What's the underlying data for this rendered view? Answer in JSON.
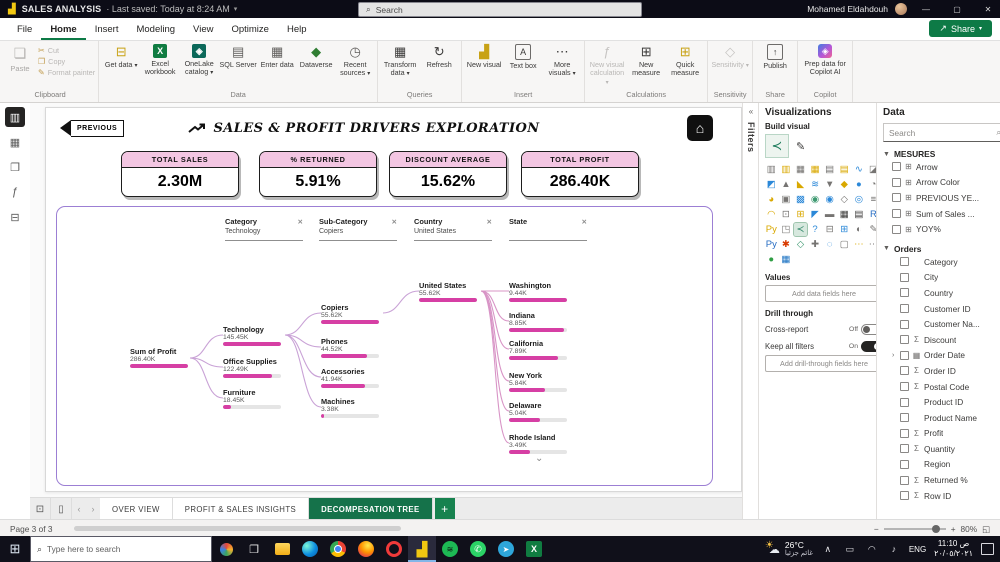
{
  "titlebar": {
    "app_title": "SALES ANALYSIS",
    "saved_status": "Last saved: Today at 8:24 AM",
    "search_placeholder": "Search",
    "user_name": "Mohamed Eldahdouh"
  },
  "menubar": {
    "tabs": [
      {
        "label": "File",
        "name": "menu-tab-file"
      },
      {
        "label": "Home",
        "cls": "active",
        "name": "menu-tab-home"
      },
      {
        "label": "Insert",
        "name": "menu-tab-insert"
      },
      {
        "label": "Modeling",
        "name": "menu-tab-modeling"
      },
      {
        "label": "View",
        "name": "menu-tab-view"
      },
      {
        "label": "Optimize",
        "name": "menu-tab-optimize"
      },
      {
        "label": "Help",
        "name": "menu-tab-help"
      }
    ],
    "share_label": "Share"
  },
  "ribbon": {
    "clipboard": {
      "label": "Clipboard",
      "paste_label": "Paste",
      "items": [
        {
          "g": "✂",
          "label": "Cut",
          "name": "cut-button"
        },
        {
          "g": "❐",
          "label": "Copy",
          "name": "copy-button"
        },
        {
          "g": "✎",
          "label": "Format painter",
          "name": "format-painter-button"
        }
      ]
    },
    "groups": [
      {
        "label": "Data",
        "items": [
          {
            "label": "Get data",
            "g": "⊟",
            "c": "#c8a215",
            "caret": "▾",
            "name": "get-data-button"
          },
          {
            "label": "Excel workbook",
            "g": "X",
            "bg": "#107c41",
            "c": "#ffffff",
            "name": "excel-workbook-button"
          },
          {
            "label": "OneLake catalog",
            "g": "◈",
            "bg": "#0c695a",
            "c": "#ffffff",
            "caret": "▾",
            "name": "onelake-catalog-button"
          },
          {
            "label": "SQL Server",
            "g": "▤",
            "c": "#5f5d5b",
            "name": "sql-server-button"
          },
          {
            "label": "Enter data",
            "g": "▦",
            "c": "#5f5d5b",
            "name": "enter-data-button"
          },
          {
            "label": "Dataverse",
            "g": "◆",
            "c": "#2f7d32",
            "name": "dataverse-button"
          },
          {
            "label": "Recent sources",
            "g": "◷",
            "c": "#5f5d5b",
            "caret": "▾",
            "name": "recent-sources-button"
          }
        ]
      },
      {
        "label": "Queries",
        "items": [
          {
            "label": "Transform data",
            "g": "▦",
            "c": "#3b3a39",
            "caret": "▾",
            "name": "transform-data-button"
          },
          {
            "label": "Refresh",
            "g": "↻",
            "c": "#3b3a39",
            "name": "refresh-button"
          }
        ]
      },
      {
        "label": "Insert",
        "items": [
          {
            "label": "New visual",
            "g": "▟",
            "c": "#c8a215",
            "name": "new-visual-button"
          },
          {
            "label": "Text box",
            "g": "A",
            "outline": true,
            "c": "#3b3a39",
            "name": "text-box-button"
          },
          {
            "label": "More visuals",
            "g": "⋯",
            "c": "#3b3a39",
            "caret": "▾",
            "name": "more-visuals-button"
          }
        ]
      },
      {
        "label": "Calculations",
        "items": [
          {
            "label": "New visual calculation",
            "g": "ƒ",
            "cls": "disabled",
            "caret": "▾",
            "name": "new-visual-calculation-button"
          },
          {
            "label": "New measure",
            "g": "⊞",
            "c": "#3b3a39",
            "name": "new-measure-button"
          },
          {
            "label": "Quick measure",
            "g": "⊞",
            "c": "#c8a215",
            "name": "quick-measure-button"
          }
        ]
      },
      {
        "label": "Sensitivity",
        "items": [
          {
            "label": "Sensitivity",
            "g": "◇",
            "cls": "disabled",
            "caret": "▾",
            "name": "sensitivity-button"
          }
        ]
      },
      {
        "label": "Share",
        "items": [
          {
            "label": "Publish",
            "g": "↑",
            "outline": true,
            "c": "#3b3a39",
            "name": "publish-button"
          }
        ]
      },
      {
        "label": "Copilot",
        "items": [
          {
            "label": "Prep data for Copilot AI",
            "g": "◈",
            "grad": true,
            "name": "prep-data-for-copilot-button"
          }
        ]
      }
    ]
  },
  "leftnav": {
    "items": [
      {
        "g": "▥",
        "cls": "active",
        "name": "report-view-icon"
      },
      {
        "g": "▦",
        "name": "table-view-icon"
      },
      {
        "g": "❐",
        "name": "model-view-icon"
      },
      {
        "g": "ƒ",
        "name": "dax-query-view-icon"
      },
      {
        "g": "⊟",
        "name": "tmdl-view-icon"
      }
    ]
  },
  "report": {
    "prev_label": "PREVIOUS",
    "title": "SALES & PROFIT DRIVERS EXPLORATION",
    "home_glyph": "⌂",
    "cards": [
      {
        "title": "TOTAL SALES",
        "value": "2.30M"
      },
      {
        "title": "% RETURNED",
        "value": "5.91%"
      },
      {
        "title": "DISCOUNT AVERAGE",
        "value": "15.62%"
      },
      {
        "title": "TOTAL PROFIT",
        "value": "286.40K"
      }
    ],
    "slicers": [
      {
        "label": "Category",
        "value": "Technology"
      },
      {
        "label": "Sub-Category",
        "value": "Copiers"
      },
      {
        "label": "Country",
        "value": "United States"
      },
      {
        "label": "State",
        "value": ""
      }
    ],
    "tree": {
      "nodes": [
        {
          "label": "Sum of Profit",
          "value": "286.40K",
          "num": 286.4,
          "col": 0
        },
        {
          "label": "Technology",
          "value": "145.45K",
          "num": 145.45,
          "col": 1
        },
        {
          "label": "Office Supplies",
          "value": "122.49K",
          "num": 122.49,
          "col": 1
        },
        {
          "label": "Furniture",
          "value": "18.45K",
          "num": 18.45,
          "col": 1
        },
        {
          "label": "Copiers",
          "value": "55.62K",
          "num": 55.62,
          "col": 2
        },
        {
          "label": "Phones",
          "value": "44.52K",
          "num": 44.52,
          "col": 2
        },
        {
          "label": "Accessories",
          "value": "41.94K",
          "num": 41.94,
          "col": 2
        },
        {
          "label": "Machines",
          "value": "3.38K",
          "num": 3.38,
          "col": 2
        },
        {
          "label": "United States",
          "value": "55.62K",
          "num": 55.62,
          "col": 3
        },
        {
          "label": "Washington",
          "value": "9.44K",
          "num": 9.44,
          "col": 4
        },
        {
          "label": "Indiana",
          "value": "8.85K",
          "num": 8.85,
          "col": 4
        },
        {
          "label": "California",
          "value": "7.89K",
          "num": 7.89,
          "col": 4
        },
        {
          "label": "New York",
          "value": "5.84K",
          "num": 5.84,
          "col": 4
        },
        {
          "label": "Delaware",
          "value": "5.04K",
          "num": 5.04,
          "col": 4
        },
        {
          "label": "Rhode Island",
          "value": "3.49K",
          "num": 3.49,
          "col": 4
        }
      ]
    }
  },
  "pages": {
    "tabs": [
      {
        "label": "OVER VIEW",
        "name": "page-tab-overview"
      },
      {
        "label": "PROFIT & SALES INSIGHTS",
        "name": "page-tab-profit-sales-insights"
      },
      {
        "label": "DECOMPESATION TREE",
        "cls": "active",
        "name": "page-tab-decomposition-tree"
      }
    ],
    "add_label": "+"
  },
  "statusbar": {
    "page_indicator": "Page 3 of 3",
    "zoom": "80%"
  },
  "filters_panel": {
    "title": "Filters"
  },
  "viz_panel": {
    "title": "Visualizations",
    "build_visual": "Build visual",
    "values_label": "Values",
    "values_placeholder": "Add data fields here",
    "drill_label": "Drill through",
    "cross_report_label": "Cross-report",
    "cross_report_state": "Off",
    "keep_filters_label": "Keep all filters",
    "keep_filters_state": "On",
    "drill_placeholder": "Add drill-through fields here",
    "icons": [
      {
        "g": "▥",
        "c": "#767472"
      },
      {
        "g": "▥",
        "c": "#d9a800"
      },
      {
        "g": "▦",
        "c": "#767472"
      },
      {
        "g": "▦",
        "c": "#d9a800"
      },
      {
        "g": "▤",
        "c": "#767472"
      },
      {
        "g": "▤",
        "c": "#d9a800"
      },
      {
        "g": "∿",
        "c": "#2b88d8"
      },
      {
        "g": "◪",
        "c": "#767472"
      },
      {
        "g": "◩",
        "c": "#2b88d8"
      },
      {
        "g": "▲",
        "c": "#767472"
      },
      {
        "g": "◣",
        "c": "#d9a800"
      },
      {
        "g": "≋",
        "c": "#2b88d8"
      },
      {
        "g": "▼",
        "c": "#767472"
      },
      {
        "g": "◆",
        "c": "#d9a800"
      },
      {
        "g": "●",
        "c": "#2b88d8"
      },
      {
        "g": "◔",
        "c": "#767472"
      },
      {
        "g": "◕",
        "c": "#d9a800"
      },
      {
        "g": "▣",
        "c": "#767472"
      },
      {
        "g": "▩",
        "c": "#2b88d8"
      },
      {
        "g": "◉",
        "c": "#3d9970"
      },
      {
        "g": "◉",
        "c": "#2b88d8"
      },
      {
        "g": "◇",
        "c": "#767472"
      },
      {
        "g": "◎",
        "c": "#2b88d8"
      },
      {
        "g": "≡",
        "c": "#767472"
      },
      {
        "g": "◠",
        "c": "#d9a800"
      },
      {
        "g": "⊡",
        "c": "#767472"
      },
      {
        "g": "⊞",
        "c": "#d9a800"
      },
      {
        "g": "◤",
        "c": "#2b88d8"
      },
      {
        "g": "▬",
        "c": "#767472"
      },
      {
        "g": "▦",
        "c": "#3b3a39"
      },
      {
        "g": "▤",
        "c": "#3b3a39"
      },
      {
        "g": "R",
        "c": "#276dc3"
      },
      {
        "g": "Py",
        "c": "#d9a800"
      },
      {
        "g": "◳",
        "c": "#767472"
      },
      {
        "g": "≺",
        "c": "#1b7a5a",
        "cls": "sel",
        "name": "decomposition-tree-icon"
      },
      {
        "g": "?",
        "c": "#2b88d8"
      },
      {
        "g": "⊟",
        "c": "#767472"
      },
      {
        "g": "⊞",
        "c": "#2b88d8"
      },
      {
        "g": "◐",
        "c": "#767472"
      },
      {
        "g": "✎",
        "c": "#767472"
      },
      {
        "g": "Py",
        "c": "#276dc3"
      },
      {
        "g": "✱",
        "c": "#d83b01"
      },
      {
        "g": "◇",
        "c": "#3d9970"
      },
      {
        "g": "✚",
        "c": "#767472"
      },
      {
        "g": "◌",
        "c": "#2b88d8"
      },
      {
        "g": "▢",
        "c": "#767472"
      },
      {
        "g": "⋯",
        "c": "#d9a800"
      },
      {
        "g": "⋯",
        "c": "#767472"
      },
      {
        "g": "●",
        "c": "#2f9e44",
        "name": "power-automate-icon"
      },
      {
        "g": "▦",
        "c": "#1971c2",
        "name": "arcgis-icon"
      }
    ]
  },
  "data_panel": {
    "title": "Data",
    "search_placeholder": "Search",
    "measures_group": "MESURES",
    "orders_group": "Orders",
    "measures": [
      {
        "icon": "⊞",
        "label": "Arrow"
      },
      {
        "icon": "⊞",
        "label": "Arrow Color"
      },
      {
        "icon": "⊞",
        "label": "PREVIOUS YE..."
      },
      {
        "icon": "⊞",
        "label": "Sum of Sales ..."
      },
      {
        "icon": "⊞",
        "label": "YOY%"
      }
    ],
    "orders": [
      {
        "label": "Category"
      },
      {
        "label": "City"
      },
      {
        "label": "Country"
      },
      {
        "label": "Customer ID"
      },
      {
        "label": "Customer Na..."
      },
      {
        "icon": "Σ",
        "label": "Discount"
      },
      {
        "exp": "›",
        "icon": "▦",
        "label": "Order Date"
      },
      {
        "icon": "Σ",
        "label": "Order ID"
      },
      {
        "icon": "Σ",
        "label": "Postal Code"
      },
      {
        "label": "Product ID"
      },
      {
        "label": "Product Name"
      },
      {
        "icon": "Σ",
        "label": "Profit"
      },
      {
        "icon": "Σ",
        "label": "Quantity"
      },
      {
        "label": "Region"
      },
      {
        "icon": "Σ",
        "label": "Returned %"
      },
      {
        "icon": "Σ",
        "label": "Row ID"
      }
    ]
  },
  "taskbar": {
    "search_placeholder": "Type here to search",
    "apps": [
      {
        "name": "task-view-icon",
        "ic": "i-taskview",
        "g": "❐"
      },
      {
        "name": "file-explorer-icon",
        "ic": "i-explorer",
        "g": ""
      },
      {
        "name": "edge-icon",
        "ic": "i-edge",
        "g": ""
      },
      {
        "name": "chrome-icon",
        "ic": "i-chrome",
        "g": ""
      },
      {
        "name": "firefox-icon",
        "ic": "i-firefox",
        "g": ""
      },
      {
        "name": "opera-icon",
        "ic": "i-opera",
        "g": ""
      },
      {
        "name": "power-bi-icon",
        "ic": "i-powerbi",
        "g": "▟",
        "cls": "active"
      },
      {
        "name": "spotify-icon",
        "ic": "i-spotify",
        "g": "≋"
      },
      {
        "name": "whatsapp-icon",
        "ic": "i-whatsapp",
        "g": "✆"
      },
      {
        "name": "telegram-icon",
        "ic": "i-telegram",
        "g": "➤"
      },
      {
        "name": "excel-icon",
        "ic": "i-excel",
        "g": "X"
      }
    ],
    "weather": {
      "temp": "26°C",
      "desc": "غائم جزئيا"
    },
    "tray": [
      {
        "g": "∧",
        "name": "hidden-icons-chevron"
      },
      {
        "g": "▭",
        "name": "battery-icon"
      },
      {
        "g": "◠",
        "name": "network-icon"
      },
      {
        "g": "♪",
        "name": "volume-icon"
      }
    ],
    "lang": "ENG",
    "time": "11:10 ص",
    "date": "٢٠/٠٥/٢٠٢١"
  }
}
